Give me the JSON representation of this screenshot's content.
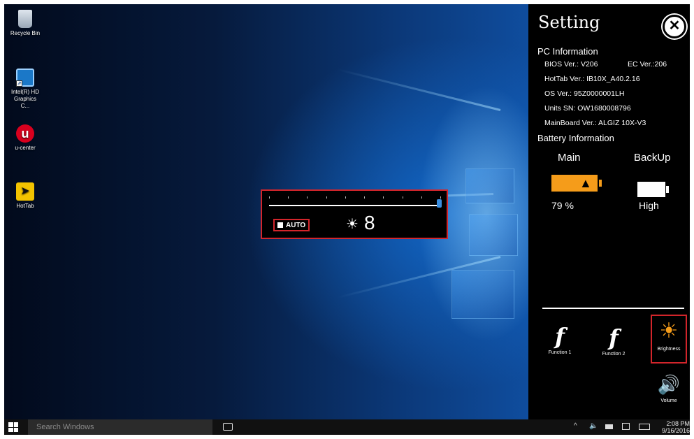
{
  "desktop": {
    "icons": [
      {
        "label": "Recycle Bin",
        "icon": "recycle-bin-icon"
      },
      {
        "label": "Intel(R) HD Graphics C...",
        "icon": "intel-graphics-icon"
      },
      {
        "label": "u-center",
        "icon": "u-center-icon",
        "glyph": "u"
      },
      {
        "label": "HotTab",
        "icon": "hottab-icon",
        "glyph": "➤"
      }
    ]
  },
  "brightness_osd": {
    "auto_label": "AUTO",
    "sun_glyph": "☀",
    "level": "8",
    "slider_fraction": 1.0,
    "tick_count": 10
  },
  "settings": {
    "title": "Setting",
    "close_glyph": "✕",
    "pc_info": {
      "heading": "PC Information",
      "bios": "BIOS Ver.: V206",
      "ec": "EC Ver.:206",
      "hottab": "HotTab Ver.: IB10X_A40.2.16",
      "os": "OS Ver.: 95Z0000001LH",
      "sn": "Units SN: OW1680008796",
      "mainboard": "MainBoard Ver.: ALGIZ 10X-V3"
    },
    "battery": {
      "heading": "Battery Information",
      "main_label": "Main",
      "main_value": "79 %",
      "main_fraction": 0.79,
      "backup_label": "BackUp",
      "backup_value": "High"
    },
    "functions": {
      "f1_glyph": "f",
      "f1_label": "Function 1",
      "f2_glyph": "f",
      "f2_label": "Function 2",
      "brightness_glyph": "☀",
      "brightness_label": "Brightness",
      "volume_glyph": "🔊",
      "volume_label": "Volume"
    }
  },
  "taskbar": {
    "search_placeholder": "Search Windows",
    "tray_chevron": "^",
    "tray_speaker": "🔈",
    "time": "2:08 PM",
    "date": "9/16/2016"
  },
  "colors": {
    "accent_orange": "#f59c1a",
    "highlight_red": "#d3252b",
    "slider_blue": "#3b8fe0"
  }
}
